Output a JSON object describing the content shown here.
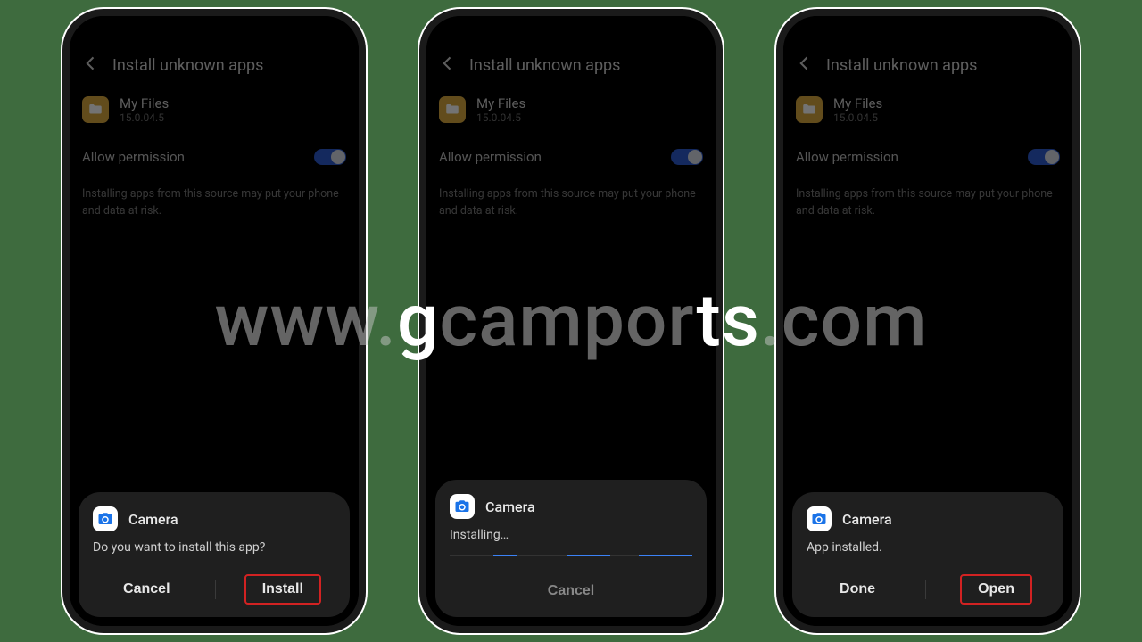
{
  "watermark": {
    "pre": "www.",
    "mid1": "g",
    "mid2": "campor",
    "mid3": "ts",
    "post": ".com"
  },
  "common": {
    "header": "Install unknown apps",
    "app_name": "My Files",
    "app_version": "15.0.04.5",
    "perm_label": "Allow permission",
    "desc": "Installing apps from this source may put your phone and data at risk."
  },
  "phones": [
    {
      "sheet": {
        "app": "Camera",
        "msg": "Do you want to install this app?",
        "left_btn": "Cancel",
        "right_btn": "Install",
        "highlight": "right",
        "mode": "two"
      }
    },
    {
      "sheet": {
        "app": "Camera",
        "msg": "Installing…",
        "center_btn": "Cancel",
        "mode": "progress"
      }
    },
    {
      "sheet": {
        "app": "Camera",
        "msg": "App installed.",
        "left_btn": "Done",
        "right_btn": "Open",
        "highlight": "right",
        "mode": "two"
      }
    }
  ]
}
